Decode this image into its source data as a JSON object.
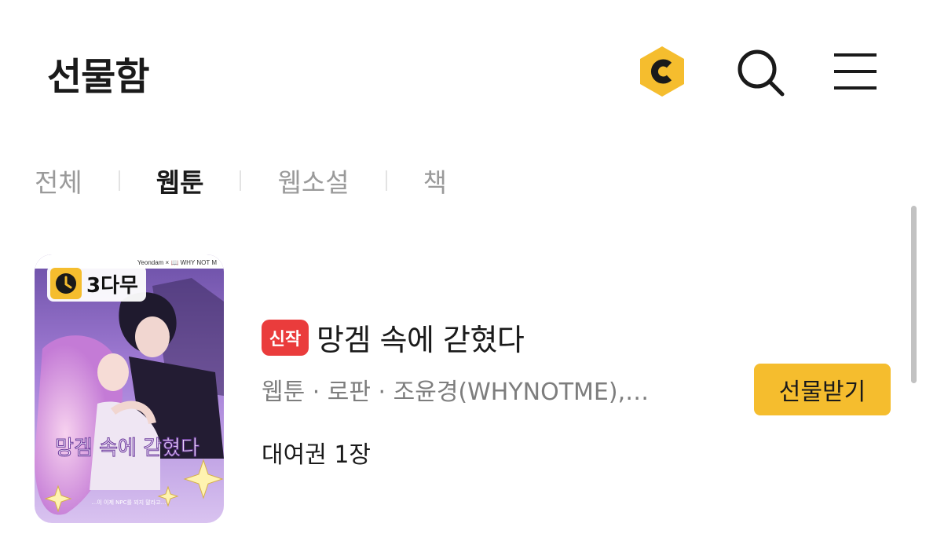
{
  "header": {
    "title": "선물함",
    "icons": {
      "coin": "coin-icon",
      "search": "search-icon",
      "menu": "hamburger-menu-icon"
    },
    "coin_color": "#f5bd2e"
  },
  "tabs": [
    {
      "label": "전체",
      "active": false
    },
    {
      "label": "웹툰",
      "active": true
    },
    {
      "label": "웹소설",
      "active": false
    },
    {
      "label": "책",
      "active": false
    }
  ],
  "gift_item": {
    "wait_badge": "3다무",
    "new_badge": "신작",
    "title": "망겜 속에 갇혔다",
    "meta": "웹툰 · 로판 · 조윤경(WHYNOTME),…",
    "rental": "대여권 1장",
    "receive_button": "선물받기",
    "cover": {
      "publisher_line": "Yeondam × 📖 WHY NOT M",
      "cover_title": "망겜 속에 갇혔다",
      "cover_subtitle": "…이 이제 NPC를 꾀지 말라고…"
    }
  },
  "colors": {
    "accent": "#f5bd2e",
    "new_badge": "#ea3c3c",
    "text_muted": "#7d7d7d"
  }
}
